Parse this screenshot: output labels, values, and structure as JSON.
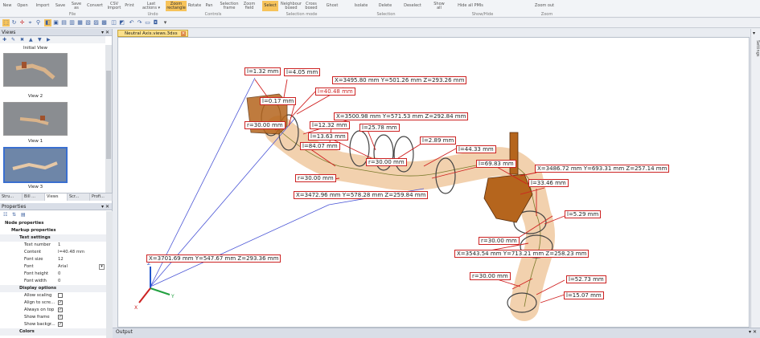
{
  "ribbon": {
    "buttons": [
      {
        "label": "New"
      },
      {
        "label": "Open"
      },
      {
        "label": "Import"
      },
      {
        "label": "Save"
      },
      {
        "label": "Save",
        "label2": "as"
      },
      {
        "label": "Convert"
      },
      {
        "label": "CSV",
        "label2": "Import"
      },
      {
        "label": "Print"
      },
      {
        "label": "Last",
        "label2": "actions ▾"
      },
      {
        "label": "Zoom",
        "label2": "rectangle"
      },
      {
        "label": "Rotate"
      },
      {
        "label": "Pan"
      },
      {
        "label": "Selection",
        "label2": "frame"
      },
      {
        "label": "Zoom",
        "label2": "field"
      },
      {
        "label": "Select"
      },
      {
        "label": "Neighbour",
        "label2": "boxed"
      },
      {
        "label": "Cross",
        "label2": "boxed"
      },
      {
        "label": "Ghost"
      },
      {
        "label": "Isolate"
      },
      {
        "label": "Delete"
      },
      {
        "label": "Deselect"
      },
      {
        "label": "Show",
        "label2": "all"
      },
      {
        "label": "Hide all PMIs"
      },
      {
        "label": "Zoom out"
      }
    ],
    "groups": [
      "File",
      "Undo",
      "Controls",
      "Selection mode",
      "Selection",
      "Show/Hide",
      "Zoom"
    ]
  },
  "views_panel": {
    "title": "Views",
    "items": [
      {
        "label": "Initial View"
      },
      {
        "label": "View 2"
      },
      {
        "label": "View 1"
      },
      {
        "label": "View 3"
      }
    ],
    "tabs": [
      "Stru...",
      "Bill ...",
      "Views",
      "Scr...",
      "Profi..."
    ]
  },
  "properties": {
    "title": "Properties",
    "sections": [
      {
        "label": "Node properties"
      },
      {
        "label": "Markup properties"
      },
      {
        "label": "Text settings"
      }
    ],
    "rows": [
      {
        "key": "Text number",
        "value": "1"
      },
      {
        "key": "Content",
        "value": "l=40.48 mm"
      },
      {
        "key": "Font size",
        "value": "12"
      },
      {
        "key": "Font",
        "value": "Arial"
      },
      {
        "key": "Font height",
        "value": "0"
      },
      {
        "key": "Font width",
        "value": "0"
      }
    ],
    "display_title": "Display options",
    "checks": [
      {
        "key": "Allow scaling",
        "checked": false
      },
      {
        "key": "Align to scre...",
        "checked": true
      },
      {
        "key": "Always on top",
        "checked": true
      },
      {
        "key": "Show frame",
        "checked": true
      },
      {
        "key": "Show backgr...",
        "checked": true
      }
    ],
    "colors_title": "Colors"
  },
  "document": {
    "tab": "Neutral Axis.views.3dxs"
  },
  "right_panel": {
    "label": "Settings"
  },
  "output": {
    "title": "Output"
  },
  "markups": [
    {
      "text": "l=1.32 mm"
    },
    {
      "text": "l=4.05 mm"
    },
    {
      "text": "X=3495.80 mm  Y=501.26 mm  Z=293.26 mm"
    },
    {
      "text": "l=40.48 mm"
    },
    {
      "text": "l=0.17 mm"
    },
    {
      "text": "X=3500.98 mm  Y=571.53 mm  Z=292.84 mm"
    },
    {
      "text": "r=30.00 mm"
    },
    {
      "text": "l=12.32 mm"
    },
    {
      "text": "l=25.78 mm"
    },
    {
      "text": "l=13.63 mm"
    },
    {
      "text": "l=2.89 mm"
    },
    {
      "text": "l=84.07 mm"
    },
    {
      "text": "l=44.33 mm"
    },
    {
      "text": "r=30.00 mm"
    },
    {
      "text": "l=69.83 mm"
    },
    {
      "text": "X=3486.72 mm  Y=693.31 mm  Z=257.14 mm"
    },
    {
      "text": "r=30.00 mm"
    },
    {
      "text": "l=33.46 mm"
    },
    {
      "text": "X=3472.96 mm  Y=578.28 mm  Z=259.84 mm"
    },
    {
      "text": "l=5.29 mm"
    },
    {
      "text": "r=30.00 mm"
    },
    {
      "text": "X=3543.54 mm  Y=713.21 mm  Z=258.23 mm"
    },
    {
      "text": "X=3701.69 mm  Y=547.67 mm  Z=293.36 mm"
    },
    {
      "text": "r=30.00 mm"
    },
    {
      "text": "l=52.73 mm"
    },
    {
      "text": "l=15.07 mm"
    }
  ],
  "axes": {
    "x": "X",
    "y": "Y",
    "z": "Z"
  },
  "colors": {
    "accent": "#f7c35a",
    "markup": "#cc2222",
    "pipe": "#f0c9a0",
    "bracket": "#b5651d"
  }
}
